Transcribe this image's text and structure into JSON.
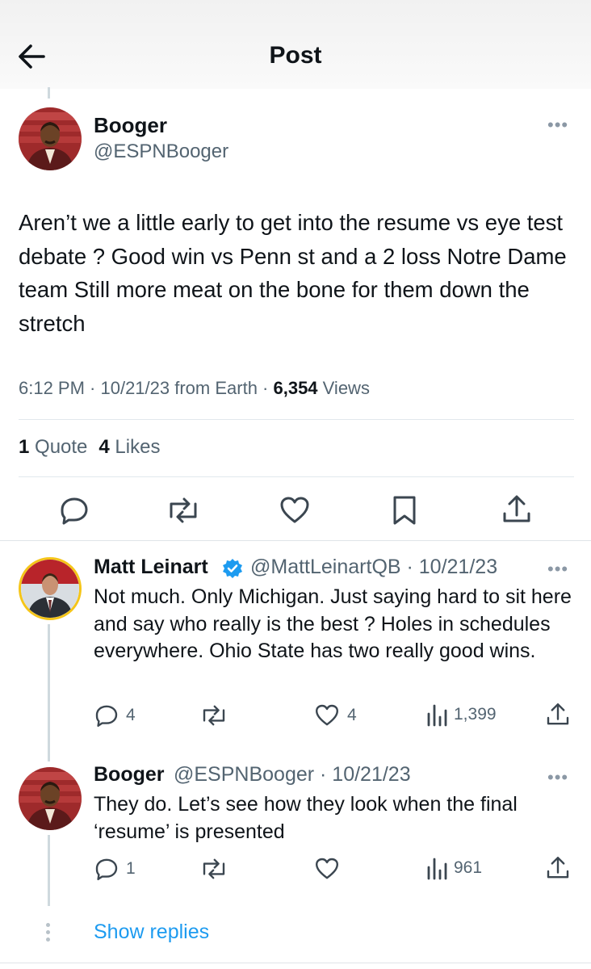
{
  "header": {
    "title": "Post"
  },
  "main_post": {
    "name": "Booger",
    "handle": "@ESPNBooger",
    "text": "Aren’t we a little early to get into the resume vs eye test debate ? Good win vs Penn st and a 2 loss Notre Dame team   Still more meat on the bone for them down the stretch",
    "time": "6:12 PM · 10/21/23 from Earth · ",
    "views_count": "6,354",
    "views_label": " Views",
    "quotes_count": "1",
    "quotes_label": " Quote",
    "likes_count": "4",
    "likes_label": " Likes",
    "icons": [
      "reply-icon",
      "repost-icon",
      "like-icon",
      "bookmark-icon",
      "share-icon"
    ]
  },
  "replies": [
    {
      "name": "Matt Leinart",
      "verified": true,
      "handle": "@MattLeinartQB · 10/21/23",
      "text": "Not much.  Only Michigan.  Just saying hard to sit here and say who really is the best ?  Holes in schedules everywhere.  Ohio State has two really good wins.",
      "reply_count": "4",
      "like_count": "4",
      "views": "1,399"
    },
    {
      "name": "Booger",
      "handle": "@ESPNBooger · 10/21/23",
      "text": "They do.   Let’s see how they look when the final ‘resume’ is presented",
      "reply_count": "1",
      "like_count": "",
      "views": "961"
    }
  ],
  "show_replies_label": "Show replies",
  "colors": {
    "link": "#1d9bf0",
    "secondary": "#536471",
    "verified": "#1d9bf0",
    "thread_line": "#cfd9de"
  }
}
